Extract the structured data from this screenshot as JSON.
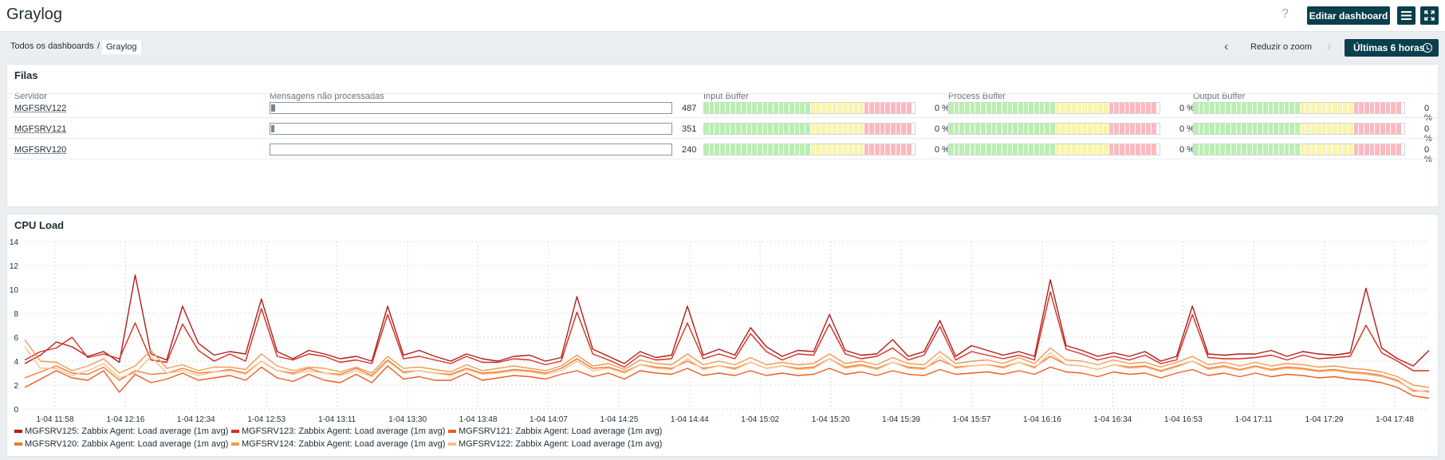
{
  "header": {
    "title": "Graylog",
    "help": "?",
    "edit_label": "Editar dashboard",
    "menu_icon": "menu-icon",
    "fullscreen_icon": "fullscreen-icon"
  },
  "breadcrumb": {
    "items": [
      "Todos os dashboards",
      "Graylog"
    ],
    "separator": "/"
  },
  "controls": {
    "zoom_out_label": "Reduzir o zoom",
    "period_label": "Últimas 6 horas"
  },
  "queues": {
    "title": "Filas",
    "columns": [
      "Servidor",
      "Mensagens não processadas",
      "Input Buffer",
      "Process Buffer",
      "Output Buffer"
    ],
    "rows": [
      {
        "host": "MGFSRV122",
        "count": "487",
        "fill": 0.01,
        "input": "0 %",
        "process": "0 %",
        "output": "0 %"
      },
      {
        "host": "MGFSRV121",
        "count": "351",
        "fill": 0.007,
        "input": "0 %",
        "process": "0 %",
        "output": "0 %"
      },
      {
        "host": "MGFSRV120",
        "count": "240",
        "fill": 0.0,
        "input": "0 %",
        "process": "0 %",
        "output": "0 %"
      }
    ]
  },
  "cpu": {
    "title": "CPU Load",
    "colors": {
      "s1": "#b01c1c",
      "s2": "#d62d1e",
      "s3": "#ec5b22",
      "s4": "#f07a30",
      "s5": "#f29a52",
      "s6": "#f8c08c"
    }
  },
  "chart_data": {
    "type": "line",
    "title": "CPU Load",
    "ylim": [
      0,
      14
    ],
    "yticks": [
      "0",
      "2",
      "4",
      "6",
      "8",
      "10",
      "12",
      "14"
    ],
    "xticks": [
      "1-04 11:58",
      "1-04 12:16",
      "1-04 12:34",
      "1-04 12:53",
      "1-04 13:11",
      "1-04 13:30",
      "1-04 13:48",
      "1-04 14:07",
      "1-04 14:25",
      "1-04 14:44",
      "1-04 15:02",
      "1-04 15:20",
      "1-04 15:39",
      "1-04 15:57",
      "1-04 16:16",
      "1-04 16:34",
      "1-04 16:53",
      "1-04 17:11",
      "1-04 17:29",
      "1-04 17:48"
    ],
    "series": [
      {
        "name": "MGFSRV125: Zabbix Agent: Load average (1m avg)",
        "color": "#b01c1c",
        "values": [
          3.8,
          4.5,
          5.6,
          5.2,
          4.4,
          4.8,
          3.9,
          11.2,
          4.6,
          4.1,
          8.6,
          5.5,
          4.5,
          4.8,
          4.6,
          9.2,
          4.8,
          4.2,
          4.9,
          4.6,
          4.2,
          4.4,
          4.0,
          8.6,
          4.5,
          4.9,
          4.4,
          4.0,
          4.6,
          4.2,
          4.0,
          4.4,
          4.5,
          4.0,
          4.3,
          9.4,
          5.0,
          4.4,
          3.8,
          4.8,
          4.3,
          4.5,
          8.6,
          4.5,
          5.0,
          4.5,
          6.8,
          5.2,
          4.4,
          4.9,
          4.8,
          7.9,
          4.9,
          4.5,
          4.6,
          5.8,
          4.4,
          4.8,
          7.4,
          4.4,
          5.3,
          4.9,
          4.5,
          4.8,
          4.4,
          10.8,
          5.3,
          4.9,
          4.4,
          4.7,
          4.4,
          4.8,
          4.0,
          4.4,
          8.6,
          4.6,
          4.5,
          4.6,
          4.6,
          4.9,
          4.4,
          4.8,
          4.6,
          4.5,
          4.7,
          10.1,
          5.1,
          4.2,
          3.6,
          4.9
        ]
      },
      {
        "name": "MGFSRV123: Zabbix Agent: Load average (1m avg)",
        "color": "#d62d1e",
        "values": [
          4.1,
          4.8,
          5.1,
          6.0,
          4.3,
          4.6,
          4.2,
          7.2,
          4.1,
          3.9,
          7.1,
          4.9,
          4.0,
          4.6,
          4.0,
          8.4,
          4.4,
          4.1,
          4.6,
          4.4,
          3.9,
          4.1,
          3.8,
          7.9,
          4.2,
          4.4,
          4.1,
          3.8,
          4.4,
          3.9,
          3.9,
          4.2,
          4.1,
          3.7,
          4.0,
          8.1,
          4.6,
          4.1,
          3.5,
          4.5,
          4.1,
          4.2,
          7.2,
          4.2,
          4.6,
          4.2,
          6.3,
          4.8,
          4.1,
          4.6,
          4.5,
          7.1,
          4.6,
          4.2,
          4.4,
          5.1,
          4.1,
          4.5,
          6.9,
          4.1,
          4.8,
          4.5,
          4.2,
          4.5,
          4.1,
          9.8,
          5.0,
          4.6,
          4.1,
          4.4,
          4.1,
          4.5,
          3.8,
          4.1,
          7.9,
          4.3,
          4.2,
          4.2,
          4.3,
          4.5,
          4.1,
          4.5,
          4.2,
          4.3,
          4.4,
          7.0,
          4.7,
          4.0,
          3.2,
          3.2
        ]
      },
      {
        "name": "MGFSRV121: Zabbix Agent: Load average (1m avg)",
        "color": "#ec5b22",
        "values": [
          1.8,
          2.5,
          3.2,
          2.6,
          2.4,
          3.2,
          1.4,
          2.9,
          2.2,
          2.5,
          3.0,
          2.4,
          2.6,
          2.8,
          2.4,
          3.5,
          2.6,
          2.3,
          2.9,
          2.4,
          2.2,
          2.9,
          2.2,
          3.6,
          2.5,
          2.7,
          2.4,
          2.4,
          3.0,
          2.4,
          2.6,
          2.8,
          2.7,
          2.5,
          2.9,
          3.2,
          2.7,
          3.0,
          2.5,
          3.2,
          3.0,
          2.9,
          3.4,
          2.8,
          3.0,
          2.8,
          3.2,
          2.8,
          3.0,
          2.8,
          2.9,
          3.4,
          2.9,
          3.1,
          2.8,
          3.2,
          2.9,
          2.8,
          3.3,
          2.9,
          3.0,
          3.1,
          2.9,
          3.2,
          2.9,
          3.5,
          3.1,
          3.0,
          2.7,
          3.1,
          2.9,
          3.0,
          2.6,
          3.0,
          3.3,
          2.8,
          3.0,
          2.7,
          3.0,
          2.7,
          2.9,
          2.8,
          2.6,
          2.7,
          2.5,
          2.4,
          2.2,
          1.8,
          1.1,
          0.9
        ]
      },
      {
        "name": "MGFSRV120: Zabbix Agent: Load average (1m avg)",
        "color": "#f07a30",
        "values": [
          2.6,
          3.1,
          3.6,
          3.0,
          2.9,
          3.5,
          2.4,
          3.2,
          2.9,
          3.0,
          3.4,
          3.0,
          3.1,
          3.3,
          3.0,
          4.0,
          3.2,
          3.0,
          3.4,
          3.0,
          2.9,
          3.4,
          2.8,
          4.1,
          3.1,
          3.2,
          3.0,
          2.9,
          3.4,
          3.0,
          3.1,
          3.3,
          3.2,
          3.0,
          3.4,
          4.2,
          3.4,
          3.5,
          3.1,
          3.7,
          3.5,
          3.4,
          4.0,
          3.4,
          3.6,
          3.4,
          3.9,
          3.4,
          3.6,
          3.4,
          3.5,
          4.2,
          3.5,
          3.7,
          3.4,
          3.9,
          3.5,
          3.4,
          4.1,
          3.5,
          3.6,
          3.7,
          3.5,
          3.9,
          3.5,
          4.4,
          3.7,
          3.6,
          3.3,
          3.7,
          3.5,
          3.6,
          3.2,
          3.6,
          4.0,
          3.4,
          3.6,
          3.3,
          3.6,
          3.3,
          3.5,
          3.4,
          3.2,
          3.3,
          3.1,
          3.0,
          2.8,
          2.4,
          1.5,
          1.5
        ]
      },
      {
        "name": "MGFSRV124: Zabbix Agent: Load average (1m avg)",
        "color": "#f29a52",
        "values": [
          5.8,
          4.0,
          3.9,
          3.2,
          3.6,
          4.2,
          3.0,
          3.6,
          4.9,
          3.4,
          3.7,
          3.2,
          3.5,
          3.5,
          3.3,
          4.6,
          3.6,
          3.2,
          3.5,
          3.4,
          3.1,
          3.5,
          3.0,
          4.4,
          3.4,
          3.5,
          3.3,
          3.1,
          3.7,
          3.2,
          3.4,
          3.6,
          3.4,
          3.2,
          3.6,
          4.5,
          3.6,
          3.8,
          3.3,
          4.1,
          3.8,
          3.7,
          4.6,
          3.7,
          4.0,
          3.7,
          4.3,
          3.7,
          3.9,
          3.7,
          3.8,
          4.6,
          3.8,
          4.0,
          3.7,
          4.3,
          3.8,
          3.7,
          4.8,
          3.8,
          4.0,
          4.1,
          3.8,
          4.3,
          3.8,
          5.1,
          4.1,
          4.0,
          3.7,
          4.1,
          3.8,
          3.9,
          3.5,
          3.9,
          4.4,
          3.7,
          3.9,
          3.6,
          3.9,
          3.6,
          3.8,
          3.7,
          3.5,
          3.6,
          3.4,
          3.3,
          3.1,
          2.7,
          2.0,
          1.8
        ]
      },
      {
        "name": "MGFSRV122: Zabbix Agent: Load average (1m avg)",
        "color": "#f8c08c",
        "values": [
          5.2,
          3.4,
          3.4,
          2.8,
          3.2,
          3.8,
          2.6,
          3.0,
          4.4,
          3.0,
          3.2,
          2.8,
          3.1,
          3.2,
          2.9,
          4.0,
          3.2,
          2.9,
          3.2,
          3.0,
          2.8,
          3.2,
          2.7,
          4.0,
          3.0,
          3.2,
          3.0,
          2.8,
          3.3,
          2.9,
          3.0,
          3.2,
          3.1,
          2.9,
          3.2,
          4.0,
          3.2,
          3.4,
          3.0,
          3.7,
          3.4,
          3.3,
          4.2,
          3.3,
          3.6,
          3.3,
          3.9,
          3.4,
          3.6,
          3.3,
          3.4,
          4.2,
          3.4,
          3.6,
          3.3,
          3.9,
          3.4,
          3.3,
          4.4,
          3.4,
          3.6,
          3.7,
          3.4,
          3.9,
          3.4,
          4.7,
          3.7,
          3.6,
          3.3,
          3.7,
          3.4,
          3.5,
          3.1,
          3.5,
          4.0,
          3.3,
          3.5,
          3.2,
          3.5,
          3.2,
          3.4,
          3.3,
          3.1,
          3.2,
          3.0,
          2.9,
          2.7,
          2.3,
          1.6,
          1.4
        ]
      }
    ]
  }
}
